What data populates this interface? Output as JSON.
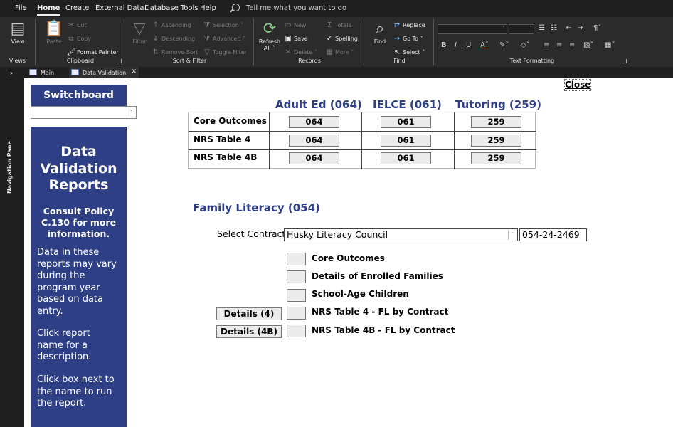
{
  "menubar": {
    "items": [
      "File",
      "Home",
      "Create",
      "External Data",
      "Database Tools",
      "Help"
    ],
    "active": "Home",
    "tell_me": "Tell me what you want to do"
  },
  "ribbon": {
    "views": {
      "label": "Views",
      "view": "View"
    },
    "clipboard": {
      "label": "Clipboard",
      "paste": "Paste",
      "cut": "Cut",
      "copy": "Copy",
      "format_painter": "Format Painter"
    },
    "sort_filter": {
      "label": "Sort & Filter",
      "filter": "Filter",
      "ascending": "Ascending",
      "descending": "Descending",
      "remove_sort": "Remove Sort",
      "selection": "Selection",
      "advanced": "Advanced",
      "toggle_filter": "Toggle Filter"
    },
    "records": {
      "label": "Records",
      "refresh": "Refresh",
      "refresh_all": "All",
      "new": "New",
      "save": "Save",
      "delete": "Delete",
      "totals": "Totals",
      "spelling": "Spelling",
      "more": "More"
    },
    "find": {
      "label": "Find",
      "find": "Find",
      "replace": "Replace",
      "goto": "Go To",
      "select": "Select"
    },
    "text_formatting": {
      "label": "Text Formatting",
      "bold": "B",
      "italic": "I",
      "underline": "U"
    }
  },
  "nav_pane": {
    "label": "Navigation Pane"
  },
  "tabs": [
    {
      "label": "Main"
    },
    {
      "label": "Data Validation"
    }
  ],
  "form": {
    "close": "Close",
    "switchboard": "Switchboard",
    "panel": {
      "title": [
        "Data",
        "Validation",
        "Reports"
      ],
      "policy": [
        "Consult Policy",
        "C.130 for more",
        "information."
      ],
      "note1": [
        "Data in these",
        "reports may vary",
        "during the",
        "program year",
        "based on data",
        "entry."
      ],
      "note2": [
        "Click report",
        "name for a",
        "description."
      ],
      "note3": [
        "Click box next to",
        "the name to run",
        "the report."
      ]
    },
    "columns": [
      "Adult Ed (064)",
      "IELCE (061)",
      "Tutoring (259)"
    ],
    "rows": [
      {
        "label": "Core Outcomes",
        "cells": [
          "064",
          "061",
          "259"
        ]
      },
      {
        "label": "NRS Table 4",
        "cells": [
          "064",
          "061",
          "259"
        ]
      },
      {
        "label": "NRS Table 4B",
        "cells": [
          "064",
          "061",
          "259"
        ]
      }
    ],
    "family_literacy": {
      "title": "Family Literacy (054)",
      "select_label": "Select Contract:",
      "contract": "Husky Literacy Council",
      "contract_id": "054-24-2469",
      "reports": [
        "Core Outcomes",
        "Details of Enrolled Families",
        "School-Age Children",
        "NRS Table 4 - FL by Contract",
        "NRS Table 4B - FL by Contract"
      ],
      "details_4": "Details (4)",
      "details_4b": "Details (4B)"
    }
  },
  "colors": {
    "panel_blue": "#2e3f85",
    "chrome_dark": "#1f1f1f",
    "ribbon": "#2b2b2b"
  }
}
